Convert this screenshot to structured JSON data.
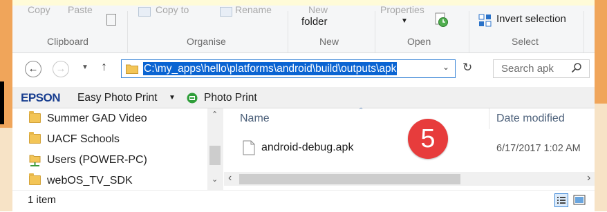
{
  "ribbon": {
    "faded": {
      "copy": "Copy",
      "paste": "Paste",
      "copy_to": "Copy to",
      "rename": "Rename",
      "new_folder_top": "New",
      "properties": "Properties"
    },
    "new_folder_bottom": "folder",
    "invert_selection": "Invert selection",
    "groups": {
      "clipboard": "Clipboard",
      "organise": "Organise",
      "new": "New",
      "open": "Open",
      "select": "Select"
    }
  },
  "address": {
    "path": "C:\\my_apps\\hello\\platforms\\android\\build\\outputs\\apk",
    "search_placeholder": "Search apk"
  },
  "epson": {
    "brand": "EPSON",
    "easy_photo_print": "Easy Photo Print",
    "photo_print": "Photo Print"
  },
  "nav_tree": [
    {
      "label": "Summer GAD Video",
      "icon": "folder-icon"
    },
    {
      "label": "UACF Schools",
      "icon": "folder-icon"
    },
    {
      "label": "Users (POWER-PC)",
      "icon": "network-drive-icon"
    },
    {
      "label": "webOS_TV_SDK",
      "icon": "folder-icon"
    }
  ],
  "file_list": {
    "columns": {
      "name": "Name",
      "date_modified": "Date modified"
    },
    "rows": [
      {
        "name": "android-debug.apk",
        "date_modified": "6/17/2017 1:02 AM"
      }
    ]
  },
  "overlay": {
    "step_badge": "5"
  },
  "status": {
    "item_count": "1 item"
  },
  "colors": {
    "accent": "#0a64d2",
    "badge": "#e73c3c",
    "frame": "#f0a55a"
  }
}
